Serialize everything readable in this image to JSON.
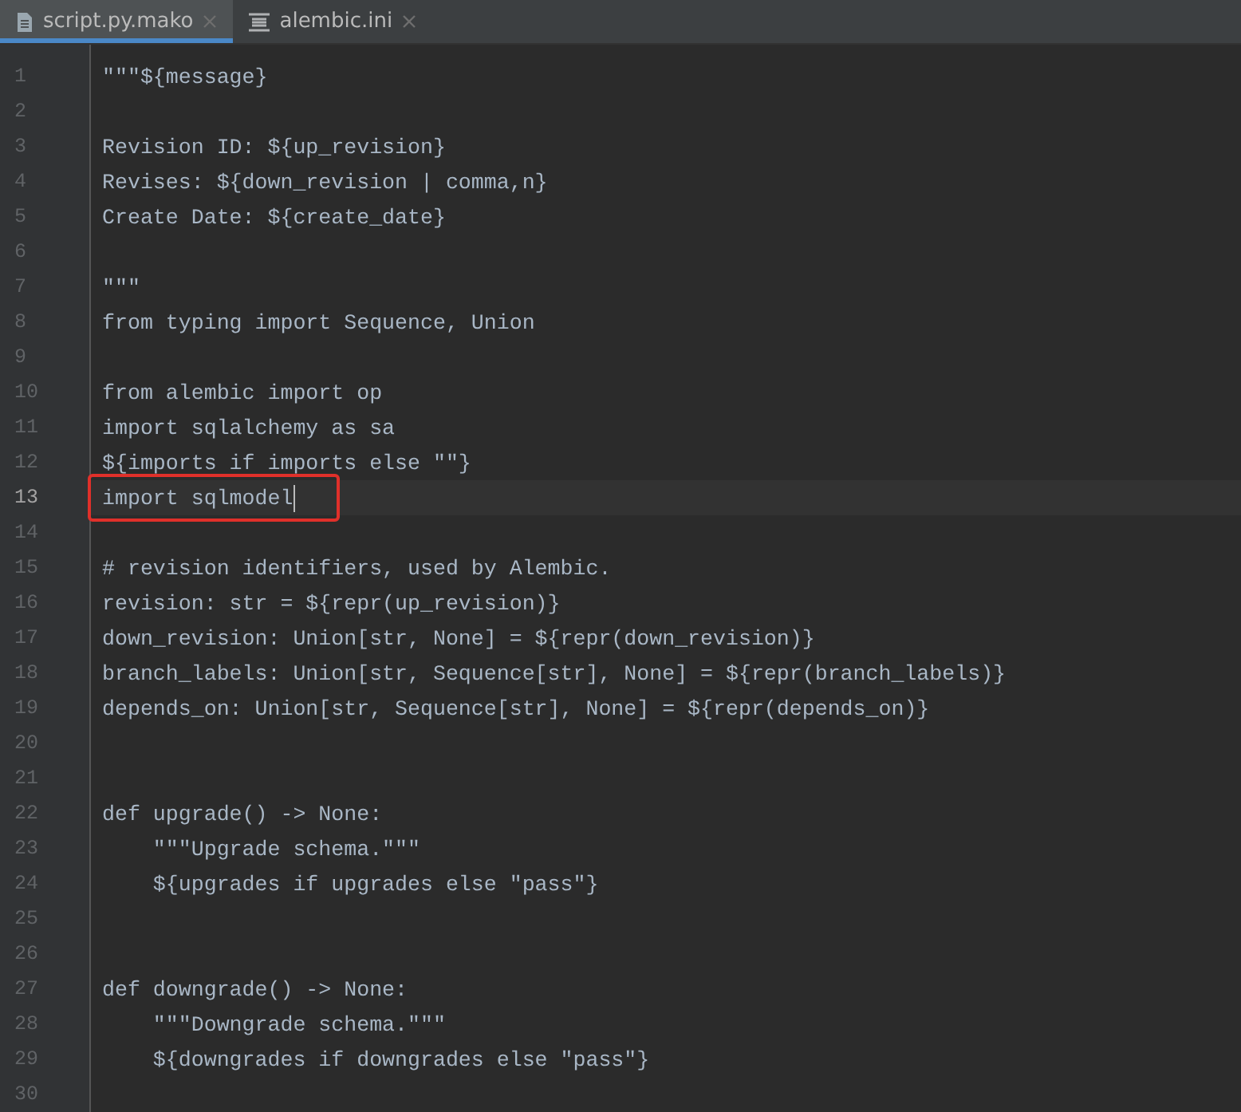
{
  "tabs": [
    {
      "label": "script.py.mako",
      "kind": "file",
      "selected": true
    },
    {
      "label": "alembic.ini",
      "kind": "settings",
      "selected": false
    }
  ],
  "lines": [
    {
      "number": "1",
      "text": "\"\"\"${message}",
      "current": false,
      "highlighted": false
    },
    {
      "number": "2",
      "current": false,
      "highlighted": false
    },
    {
      "number": "3",
      "text": "Revision ID: ${up_revision}",
      "current": false,
      "highlighted": false
    },
    {
      "number": "4",
      "text": "Revises: ${down_revision | comma,n}",
      "current": false,
      "highlighted": false
    },
    {
      "number": "5",
      "text": "Create Date: ${create_date}",
      "current": false,
      "highlighted": false
    },
    {
      "number": "6",
      "current": false,
      "highlighted": false
    },
    {
      "number": "7",
      "text": "\"\"\"",
      "current": false,
      "highlighted": false
    },
    {
      "number": "8",
      "text": "from typing import Sequence, Union",
      "current": false,
      "highlighted": false
    },
    {
      "number": "9",
      "current": false,
      "highlighted": false
    },
    {
      "number": "10",
      "text": "from alembic import op",
      "current": false,
      "highlighted": false
    },
    {
      "number": "11",
      "text": "import sqlalchemy as sa",
      "current": false,
      "highlighted": false
    },
    {
      "number": "12",
      "text": "${imports if imports else \"\"}",
      "current": false,
      "highlighted": false
    },
    {
      "number": "13",
      "text": "import sqlmodel",
      "current": true,
      "highlighted": true
    },
    {
      "number": "14",
      "current": false,
      "highlighted": false
    },
    {
      "number": "15",
      "text": "# revision identifiers, used by Alembic.",
      "current": false,
      "highlighted": false
    },
    {
      "number": "16",
      "text": "revision: str = ${repr(up_revision)}",
      "current": false,
      "highlighted": false
    },
    {
      "number": "17",
      "text": "down_revision: Union[str, None] = ${repr(down_revision)}",
      "current": false,
      "highlighted": false
    },
    {
      "number": "18",
      "text": "branch_labels: Union[str, Sequence[str], None] = ${repr(branch_labels)}",
      "current": false,
      "highlighted": false
    },
    {
      "number": "19",
      "text": "depends_on: Union[str, Sequence[str], None] = ${repr(depends_on)}",
      "current": false,
      "highlighted": false
    },
    {
      "number": "20",
      "current": false,
      "highlighted": false
    },
    {
      "number": "21",
      "current": false,
      "highlighted": false
    },
    {
      "number": "22",
      "text": "def upgrade() -> None:",
      "current": false,
      "highlighted": false
    },
    {
      "number": "23",
      "text": "    \"\"\"Upgrade schema.\"\"\"",
      "current": false,
      "highlighted": false
    },
    {
      "number": "24",
      "text": "    ${upgrades if upgrades else \"pass\"}",
      "current": false,
      "highlighted": false
    },
    {
      "number": "25",
      "current": false,
      "highlighted": false
    },
    {
      "number": "26",
      "current": false,
      "highlighted": false
    },
    {
      "number": "27",
      "text": "def downgrade() -> None:",
      "current": false,
      "highlighted": false
    },
    {
      "number": "28",
      "text": "    \"\"\"Downgrade schema.\"\"\"",
      "current": false,
      "highlighted": false
    },
    {
      "number": "29",
      "text": "    ${downgrades if downgrades else \"pass\"}",
      "current": false,
      "highlighted": false
    },
    {
      "number": "30",
      "current": false,
      "highlighted": false
    }
  ]
}
